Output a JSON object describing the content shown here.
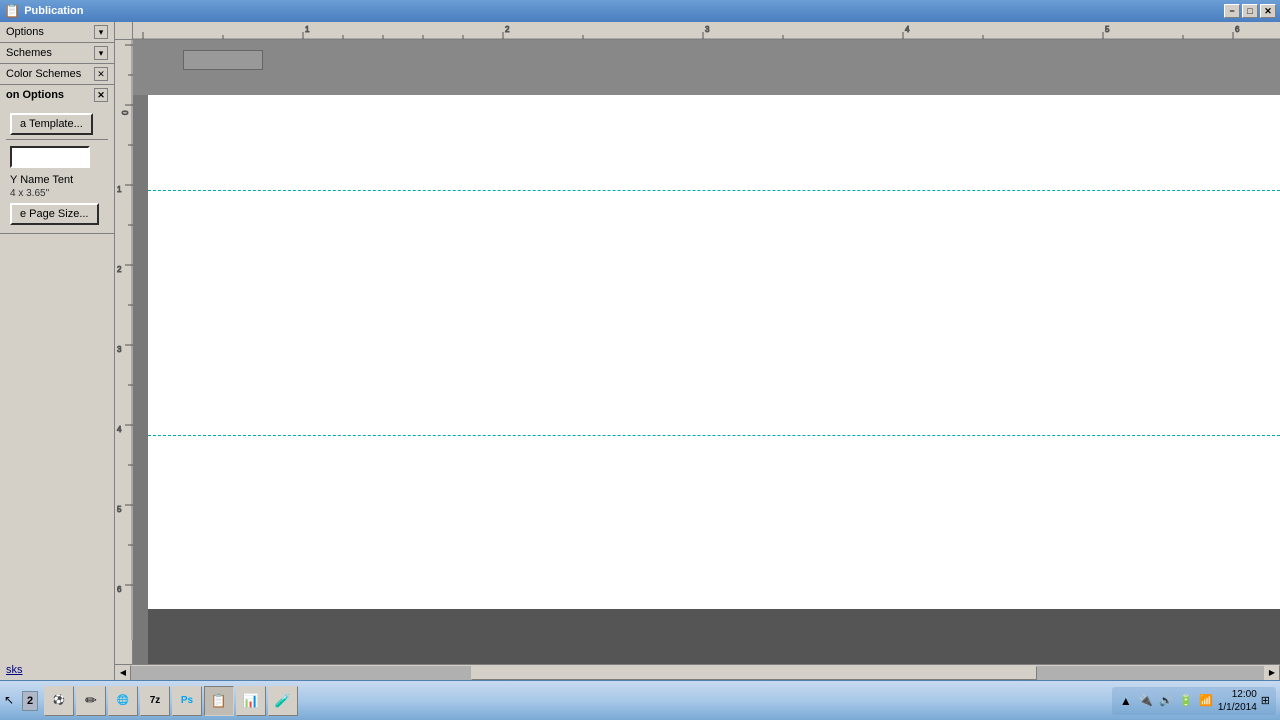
{
  "titlebar": {
    "title": "Publication",
    "minimize_label": "−",
    "maximize_label": "□",
    "close_label": "✕"
  },
  "leftpanel": {
    "sections": [
      {
        "id": "options",
        "label": "Options",
        "collapsed": true
      },
      {
        "id": "schemes",
        "label": "Schemes",
        "collapsed": true
      },
      {
        "id": "color_schemes",
        "label": "Color Schemes",
        "collapsed": true
      }
    ],
    "pub_options": {
      "header": "on Options",
      "close_label": "✕",
      "template_btn": "a Template...",
      "name_input_placeholder": "",
      "name_input_value": "",
      "pub_name": "Y Name Tent",
      "pub_size": "4 x 3.65\"",
      "page_size_btn": "e Page Size...",
      "tasks_link": "sks"
    }
  },
  "canvas": {
    "guide1_top_pct": 27,
    "guide2_top_pct": 72
  },
  "taskbar": {
    "cursor_btn_label": "2",
    "app_btn_label": "",
    "systray": {
      "time": "▲",
      "icons": [
        "🔊",
        "📶",
        "🔋"
      ]
    },
    "apps": [
      {
        "id": "ball",
        "icon": "⚽"
      },
      {
        "id": "pen",
        "icon": "✏"
      },
      {
        "id": "chrome",
        "icon": "🌐"
      },
      {
        "id": "7zip",
        "icon": "📦"
      },
      {
        "id": "ps",
        "icon": "Ps"
      },
      {
        "id": "publisher",
        "icon": "📋"
      },
      {
        "id": "calc",
        "icon": "📊"
      },
      {
        "id": "flask",
        "icon": "🧪"
      }
    ]
  }
}
